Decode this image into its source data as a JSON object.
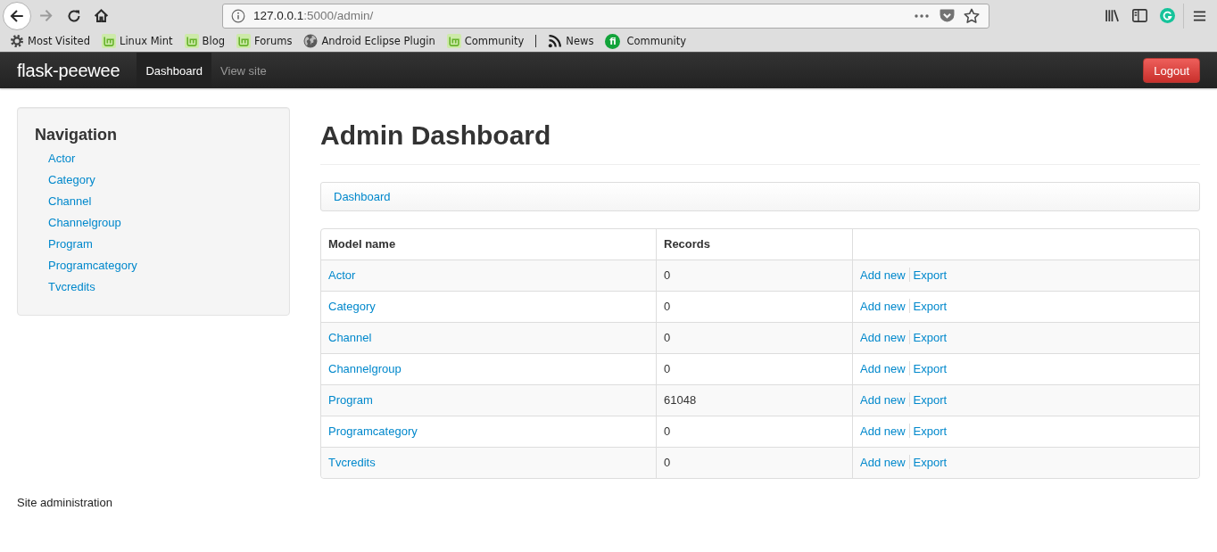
{
  "browser": {
    "nav_buttons": [
      {
        "kind": "back",
        "disabled": false
      },
      {
        "kind": "forward",
        "disabled": true
      },
      {
        "kind": "reload",
        "disabled": false
      },
      {
        "kind": "home",
        "disabled": false
      }
    ],
    "url": {
      "host": "127.0.0.1",
      "path": ":5000/admin/"
    },
    "page_actions": [
      {
        "kind": "more"
      },
      {
        "kind": "pocket"
      },
      {
        "kind": "star"
      }
    ],
    "toolbar": [
      {
        "kind": "library"
      },
      {
        "kind": "sidebar"
      },
      {
        "kind": "extension"
      },
      {
        "kind": "menu"
      }
    ],
    "bookmarks": [
      {
        "kind": "gear",
        "label": "Most Visited"
      },
      {
        "kind": "mint",
        "label": "Linux Mint"
      },
      {
        "kind": "mint",
        "label": "Blog"
      },
      {
        "kind": "mint",
        "label": "Forums"
      },
      {
        "kind": "globe",
        "label": "Android Eclipse Plugin"
      },
      {
        "kind": "mint",
        "label": "Community"
      },
      {
        "kind": "separator"
      },
      {
        "kind": "rss",
        "label": "News"
      },
      {
        "kind": "badge",
        "badge": "fi",
        "label": "Community"
      }
    ]
  },
  "navbar": {
    "brand": "flask-peewee",
    "items": [
      {
        "label": "Dashboard",
        "selected": true
      },
      {
        "label": "View site",
        "selected": false
      }
    ],
    "logout": "Logout"
  },
  "sidebar": {
    "title": "Navigation",
    "items": [
      "Actor",
      "Category",
      "Channel",
      "Channelgroup",
      "Program",
      "Programcategory",
      "Tvcredits"
    ]
  },
  "main": {
    "title": "Admin Dashboard",
    "breadcrumb": [
      "Dashboard"
    ],
    "table": {
      "columns": [
        "Model name",
        "Records"
      ],
      "rows": [
        {
          "name": "Actor",
          "records": "0",
          "actions": [
            "Add new",
            "Export"
          ]
        },
        {
          "name": "Category",
          "records": "0",
          "actions": [
            "Add new",
            "Export"
          ]
        },
        {
          "name": "Channel",
          "records": "0",
          "actions": [
            "Add new",
            "Export"
          ]
        },
        {
          "name": "Channelgroup",
          "records": "0",
          "actions": [
            "Add new",
            "Export"
          ]
        },
        {
          "name": "Program",
          "records": "61048",
          "actions": [
            "Add new",
            "Export"
          ]
        },
        {
          "name": "Programcategory",
          "records": "0",
          "actions": [
            "Add new",
            "Export"
          ]
        },
        {
          "name": "Tvcredits",
          "records": "0",
          "actions": [
            "Add new",
            "Export"
          ]
        }
      ]
    }
  },
  "footer": "Site administration"
}
